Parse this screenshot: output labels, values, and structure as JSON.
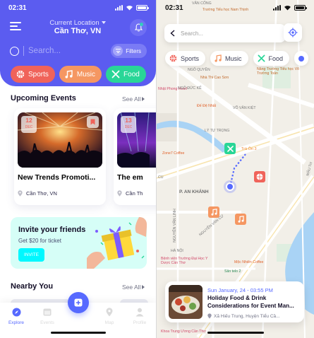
{
  "left_screen": {
    "status": {
      "time": "02:31"
    },
    "header": {
      "location_label": "Current Location",
      "location_value": "Cần Thơ, VN"
    },
    "search": {
      "placeholder": "Search...",
      "filters_label": "Filters"
    },
    "categories": [
      {
        "label": "Sports",
        "color": "#f0635a",
        "icon": "basketball-icon"
      },
      {
        "label": "Music",
        "color": "#f59762",
        "icon": "music-note-icon"
      },
      {
        "label": "Food",
        "color": "#29d697",
        "icon": "fork-knife-icon"
      }
    ],
    "upcoming": {
      "title": "Upcoming Events",
      "see_all": "See All",
      "events": [
        {
          "day": "12",
          "month": "DEC",
          "name": "New Trends Promoti...",
          "location": "Cần Thơ, VN"
        },
        {
          "day": "13",
          "month": "DEC",
          "name": "The em",
          "location": "Cần Th"
        }
      ]
    },
    "invite": {
      "title": "Invite your friends",
      "subtitle": "Get $20 for ticket",
      "button": "INVITE"
    },
    "nearby": {
      "title": "Nearby You",
      "see_all": "See All"
    },
    "nav": [
      {
        "label": "Explore",
        "icon": "compass-icon",
        "active": true
      },
      {
        "label": "Events",
        "icon": "calendar-icon",
        "active": false
      },
      {
        "label": "Map",
        "icon": "map-pin-icon",
        "active": false
      },
      {
        "label": "Profile",
        "icon": "profile-icon",
        "active": false
      }
    ]
  },
  "right_screen": {
    "status": {
      "time": "02:31"
    },
    "search": {
      "placeholder": "Search..."
    },
    "categories": [
      {
        "label": "Sports",
        "color": "#f0635a",
        "icon": "basketball-icon"
      },
      {
        "label": "Music",
        "color": "#f59762",
        "icon": "music-note-icon"
      },
      {
        "label": "Food",
        "color": "#29d697",
        "icon": "fork-knife-icon"
      }
    ],
    "map_labels": {
      "street_van_cong": "VĂN CỐNG",
      "school": "Trường Tiểu học Nam Thịnh",
      "ngo_quyen": "NGÔ QUYỀN",
      "cao_son": "Nhà Thi Cao Sơn",
      "nang_truong": "Năng Trường Tiểu học Võ Trường Toản",
      "nhat_phong": "Nhật Phong Hotel",
      "ngo_duc_ke": "NGÔ ĐỨC KẾ",
      "de_nhat": "Đế Đệ Nhất",
      "vo_van_kiet": "VÕ VĂN KIỆT",
      "zone7": "Zone7 Coffee",
      "ly_tu_trong": "LÝ TỰ TRỌNG",
      "tra_on": "Trà Ôn 3",
      "cu": "CU",
      "an_khanh": "P. AN KHÁNH",
      "nguyen_van_cu": "NGUYỄN VĂN CỪ",
      "nguyen_van_linh": "NGUYỄN VĂN LINH",
      "ha_noi": "HÀ NỘI",
      "maui": "MẬU TH",
      "benh_vien": "Bệnh viện Trường Đại Học Y Dược Cần Thơ",
      "moc_nhien": "Mộc Nhiên Coffee",
      "san_telo": "Sân telo 2",
      "khoa_trung": "Khoa Trung Ương Cần Thơ"
    },
    "event_card": {
      "date": "Sun January, 24 - 03:55 PM",
      "title": "Holiday Food & Drink Considerations for Event Man...",
      "address": "Xã Hiếu Trung, Huyện Tiểu Cầ..."
    }
  }
}
